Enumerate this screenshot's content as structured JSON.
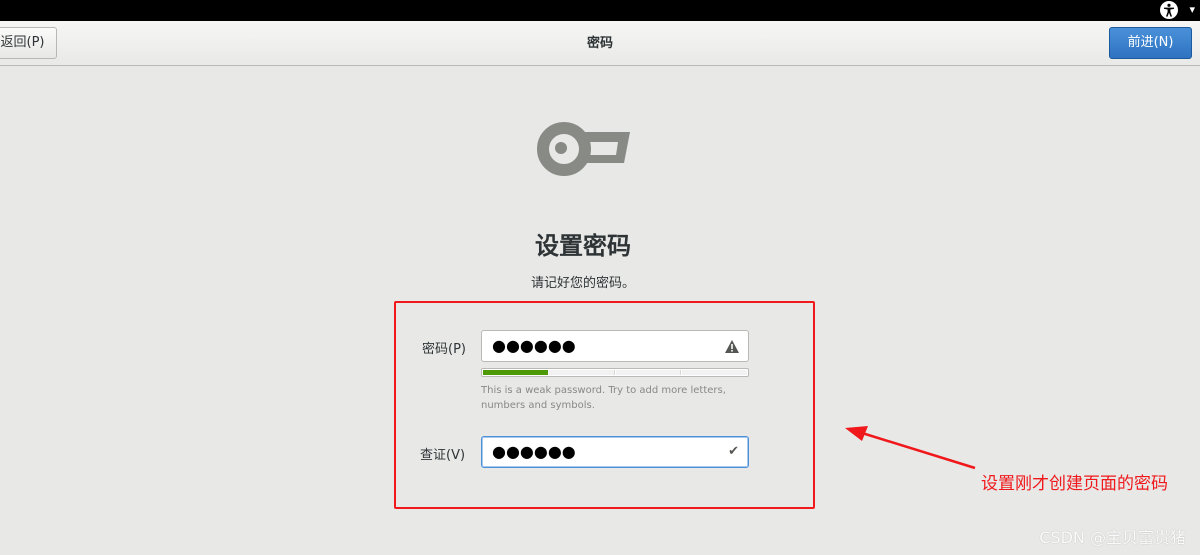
{
  "topbar": {
    "accessibility_icon": "accessibility-icon",
    "menu_caret": "▾"
  },
  "header": {
    "back_label": "返回(P)",
    "title": "密码",
    "next_label": "前进(N)"
  },
  "main": {
    "icon": "key-icon",
    "title": "设置密码",
    "subtitle": "请记好您的密码。"
  },
  "password_field": {
    "label": "密码(P)",
    "value_masked": "●●●●●●",
    "status_icon": "warning-icon"
  },
  "strength_meter": {
    "level_fraction": 0.25,
    "segments": 4,
    "filled_segments": 1,
    "fill_color": "#4e9a06"
  },
  "hint": {
    "text": "This is a weak password. Try to add more letters, numbers and symbols."
  },
  "confirm_field": {
    "label": "查证(V)",
    "value_masked": "●●●●●●",
    "status_icon": "check-icon"
  },
  "annotation": {
    "text": "设置刚才创建页面的密码",
    "color": "#f0181b"
  },
  "watermark": {
    "text": "CSDN @宝贝富贵猪"
  },
  "colors": {
    "accent": "#4a90d9",
    "highlight": "#f0181b"
  }
}
